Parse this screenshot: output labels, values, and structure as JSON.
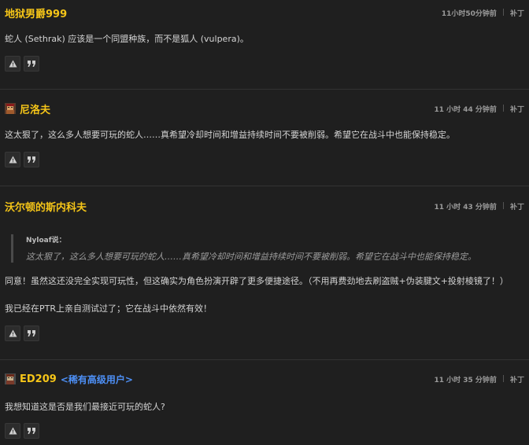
{
  "comments": [
    {
      "author": "地狱男爵999",
      "time": "11小时50分钟前",
      "separator": "|",
      "reply": "补丁",
      "lines": [
        "蛇人 (Sethrak) 应该是一个同盟种族，而不是狐人 (vulpera)。"
      ]
    },
    {
      "author": "尼洛夫",
      "avatar_icon": "character-avatar-icon",
      "time": "11 小时 44 分钟前",
      "separator": "|",
      "reply": "补丁",
      "lines": [
        "这太狠了，这么多人想要可玩的蛇人……真希望冷却时间和增益持续时间不要被削弱。希望它在战斗中也能保持稳定。"
      ]
    },
    {
      "author": "沃尔顿的斯内科夫",
      "time": "11 小时 43 分钟前",
      "separator": "|",
      "reply": "补丁",
      "quote": {
        "author": "Nyloaf说：",
        "text": "这太狠了，这么多人想要可玩的蛇人……真希望冷却时间和增益持续时间不要被削弱。希望它在战斗中也能保持稳定。"
      },
      "lines": [
        "同意！虽然这还没完全实现可玩性，但这确实为角色扮演开辟了更多便捷途径。（不用再费劲地去刷盗贼+伪装腱文+投射棱镜了！）",
        "我已经在PTR上亲自测试过了；它在战斗中依然有效！"
      ]
    },
    {
      "author": "ED209",
      "avatar_icon": "character-avatar-icon",
      "rank": "<稀有高级用户>",
      "time": "11 小时 35 分钟前",
      "separator": "|",
      "reply": "补丁",
      "lines": [
        "我想知道这是否是我们最接近可玩的蛇人?"
      ]
    }
  ],
  "buttons": {
    "report_icon": "warning-icon",
    "quote_icon": "quote-icon"
  },
  "colors": {
    "background": "#1f1f1f",
    "author": "#f5c518",
    "rank": "#4d8ff5"
  }
}
